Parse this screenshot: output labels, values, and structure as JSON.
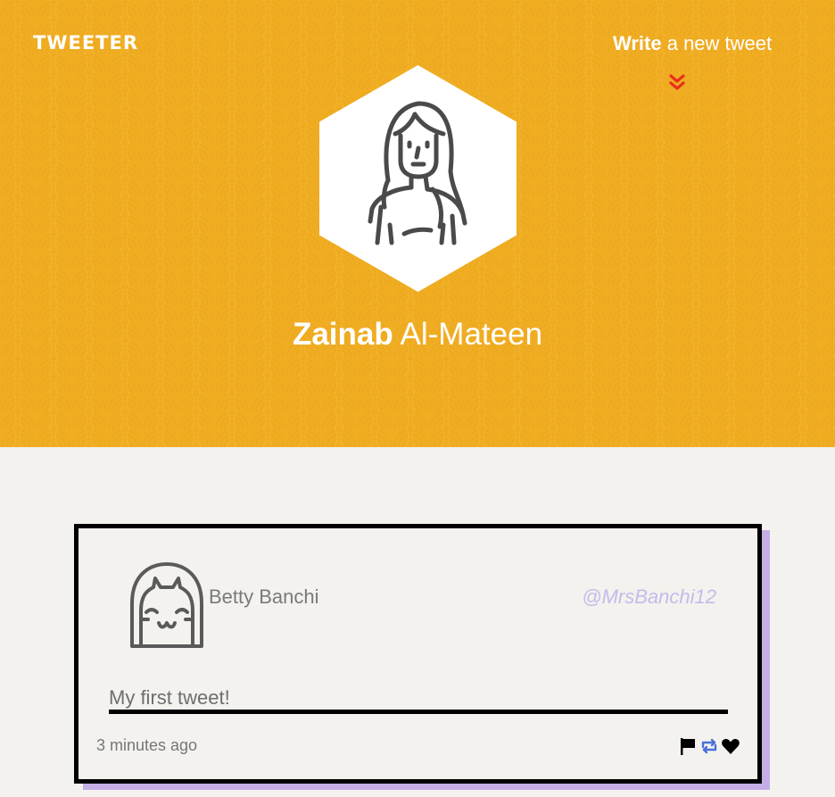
{
  "nav": {
    "logo": "TWEETER",
    "compose_bold": "Write",
    "compose_rest": " a new tweet",
    "chevron_icon": "double-chevron-down-icon"
  },
  "profile": {
    "first_name": "Zainab",
    "last_name": " Al-Mateen",
    "avatar_icon": "woman-avatar-icon"
  },
  "tweets": [
    {
      "author": "Betty Banchi",
      "handle": "@MrsBanchi12",
      "text": "My first tweet!",
      "time": "3 minutes ago",
      "avatar_icon": "smiling-girl-avatar-icon",
      "actions": [
        "flag-icon",
        "retweet-icon",
        "heart-icon"
      ]
    }
  ],
  "colors": {
    "header_bg": "#f0ad22",
    "page_bg": "#f3f2ee",
    "accent_shadow": "#c4aee6",
    "handle": "#c8b9ea",
    "chevron": "#e8301c",
    "retweet": "#4a6fd8"
  }
}
